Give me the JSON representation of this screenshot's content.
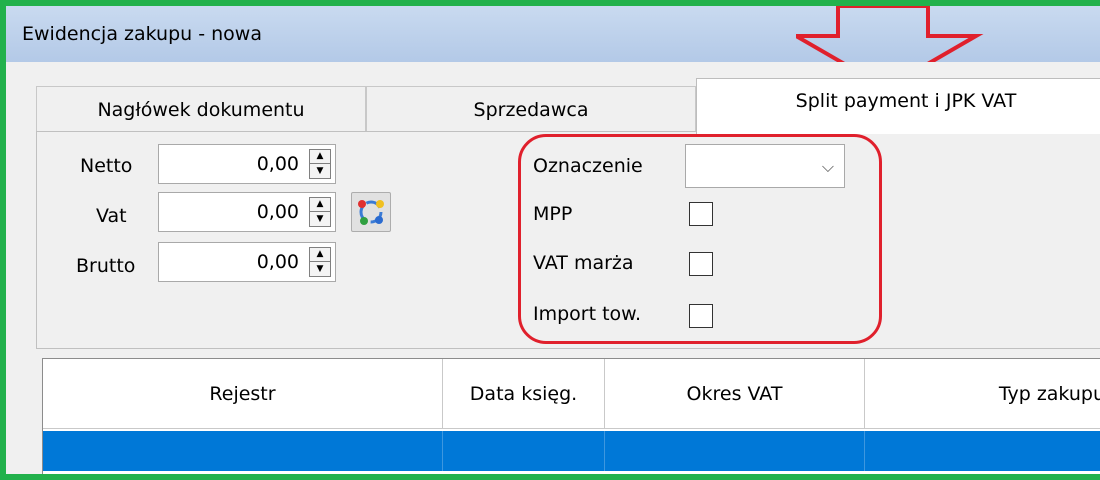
{
  "window": {
    "title": "Ewidencja zakupu - nowa"
  },
  "tabs": [
    {
      "label": "Nagłówek dokumentu",
      "active": false
    },
    {
      "label": "Sprzedawca",
      "active": false
    },
    {
      "label": "Split payment i JPK VAT",
      "active": true
    }
  ],
  "amounts": {
    "netto": {
      "label": "Netto",
      "value": "0,00"
    },
    "vat": {
      "label": "Vat",
      "value": "0,00"
    },
    "brutto": {
      "label": "Brutto",
      "value": "0,00"
    }
  },
  "split": {
    "oznaczenie": {
      "label": "Oznaczenie",
      "value": ""
    },
    "mpp": {
      "label": "MPP",
      "checked": false
    },
    "vat_marza": {
      "label": "VAT marża",
      "checked": false
    },
    "import_tow": {
      "label": "Import tow.",
      "checked": false
    }
  },
  "grid": {
    "columns": [
      "Rejestr",
      "Data księg.",
      "Okres VAT",
      "Typ zakupu"
    ],
    "selected_row_color": "#0078d7"
  },
  "annotation_colors": {
    "frame": "#22b14c",
    "highlight": "#e0202c"
  },
  "icons": {
    "calc": "recalculate-icon",
    "spin": "spin-updown-icon",
    "dropdown": "chevron-down-icon"
  }
}
